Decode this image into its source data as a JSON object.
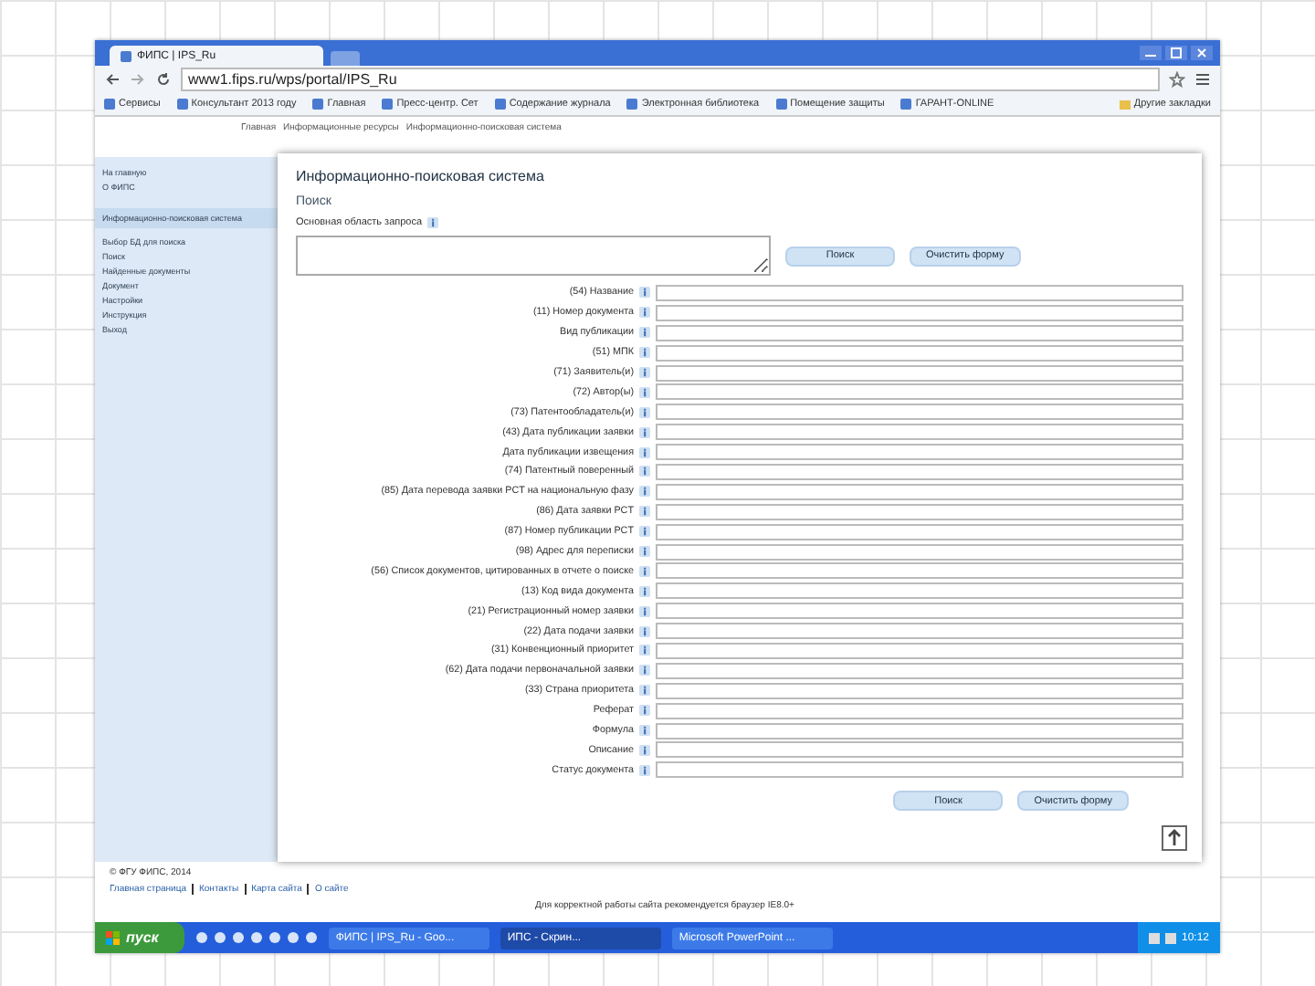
{
  "browser": {
    "tab": "ФИПС | IPS_Ru",
    "url": "www1.fips.ru/wps/portal/IPS_Ru",
    "bookmarks": [
      "Сервисы",
      "Консультант 2013 году",
      "Главная",
      "Пресс-центр. Сет",
      "Содержание журнала",
      "Электронная библиотека",
      "Помещение защиты",
      "ГАРАНТ-ONLINE"
    ],
    "other_bookmarks": "Другие закладки"
  },
  "breadcrumb": [
    "Главная",
    "Информационные ресурсы",
    "Информационно-поисковая система"
  ],
  "sidebar": {
    "top": "На главную",
    "link": "О ФИПС",
    "section": "Информационно-поисковая система",
    "items": [
      "Выбор БД для поиска",
      "Поиск",
      "Найденные документы",
      "Документ",
      "Настройки",
      "Инструкция",
      "Выход"
    ]
  },
  "panel": {
    "title": "Информационно-поисковая система",
    "heading": "Поиск",
    "query_label": "Основная область запроса",
    "buttons": [
      "Поиск",
      "Очистить форму"
    ],
    "fields": [
      {
        "label": "(54) Название"
      },
      {
        "label": "(11) Номер документа"
      },
      {
        "label": "Вид публикации"
      },
      {
        "label": "(51) МПК"
      },
      {
        "label": "(71) Заявитель(и)"
      },
      {
        "label": "(72) Автор(ы)"
      },
      {
        "label": "(73) Патентообладатель(и)"
      },
      {
        "label": "(43) Дата публикации заявки"
      },
      {
        "label": "Дата публикации извещения"
      },
      {
        "label": "(74) Патентный поверенный"
      },
      {
        "label": "(85) Дата перевода заявки PCT на национальную фазу"
      },
      {
        "label": "(86) Дата заявки PCT"
      },
      {
        "label": "(87) Номер публикации PCT"
      },
      {
        "label": "(98) Адрес для переписки"
      },
      {
        "label": "(56) Список документов, цитированных в отчете о поиске"
      },
      {
        "label": "(13) Код вида документа"
      },
      {
        "label": "(21) Регистрационный номер заявки"
      },
      {
        "label": "(22) Дата подачи заявки"
      },
      {
        "label": "(31) Конвенционный приоритет"
      },
      {
        "label": "(62) Дата подачи первоначальной заявки"
      },
      {
        "label": "(33) Страна приоритета"
      },
      {
        "label": "Реферат"
      },
      {
        "label": "Формула"
      },
      {
        "label": "Описание"
      },
      {
        "label": "Статус документа"
      }
    ],
    "bottom_buttons": [
      "Поиск",
      "Очистить форму"
    ]
  },
  "footer": {
    "copyright": "© ФГУ ФИПС, 2014",
    "links": [
      "Главная страница",
      "Контакты",
      "Карта сайта",
      "О сайте"
    ],
    "note": "Для корректной работы сайта рекомендуется браузер IE8.0+"
  },
  "taskbar": {
    "start": "пуск",
    "tasks": [
      {
        "label": "ФИПС | IPS_Ru - Goo...",
        "selected": false
      },
      {
        "label": "ИПС - Скрин...",
        "selected": true
      },
      {
        "label": "Microsoft PowerPoint ...",
        "selected": false
      }
    ],
    "clock": "10:12"
  }
}
